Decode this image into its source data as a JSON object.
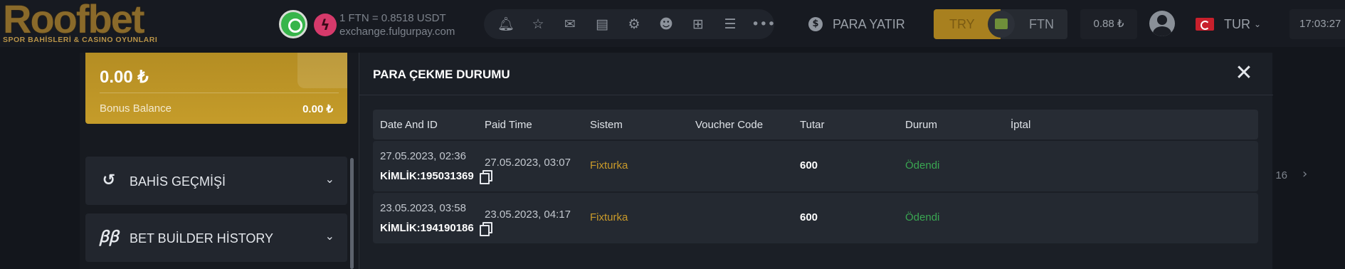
{
  "header": {
    "logo_text": "Roofbet",
    "logo_subtitle": "SPOR BAHİSLERİ & CASINO OYUNLARI",
    "exchange_rate": "1 FTN = 0.8518 USDT",
    "exchange_site": "exchange.fulgurpay.com",
    "deposit_label": "PARA YATIR",
    "currencies": [
      "TRY",
      "FTN"
    ],
    "balance": "0.88 ₺",
    "language": "TUR",
    "time": "17:03:27"
  },
  "background": {
    "pager": "/ 16"
  },
  "sidebar": {
    "balance": "0.00 ₺",
    "bonus_label": "Bonus Balance",
    "bonus_value": "0.00 ₺",
    "items": [
      {
        "label": "BAHİS GEÇMİŞİ",
        "icon": "history-icon"
      },
      {
        "label": "BET BUİLDER HİSTORY",
        "icon": "bet-builder-icon"
      }
    ]
  },
  "modal": {
    "title": "PARA ÇEKME DURUMU",
    "columns": [
      "Date And ID",
      "Paid Time",
      "Sistem",
      "Voucher Code",
      "Tutar",
      "Durum",
      "İptal"
    ],
    "rows": [
      {
        "date": "27.05.2023, 02:36",
        "id": "KİMLİK:195031369",
        "paid_time": "27.05.2023, 03:07",
        "system": "Fixturka",
        "voucher": "",
        "amount": "600",
        "status": "Ödendi",
        "cancel": ""
      },
      {
        "date": "23.05.2023, 03:58",
        "id": "KİMLİK:194190186",
        "paid_time": "23.05.2023, 04:17",
        "system": "Fixturka",
        "voucher": "",
        "amount": "600",
        "status": "Ödendi",
        "cancel": ""
      }
    ]
  },
  "colors": {
    "accent_gold": "#c59c2a",
    "status_paid": "#3aa652",
    "system_text": "#c99a2a",
    "whatsapp": "#37b54a",
    "ftn_icon": "#d63a6b"
  }
}
